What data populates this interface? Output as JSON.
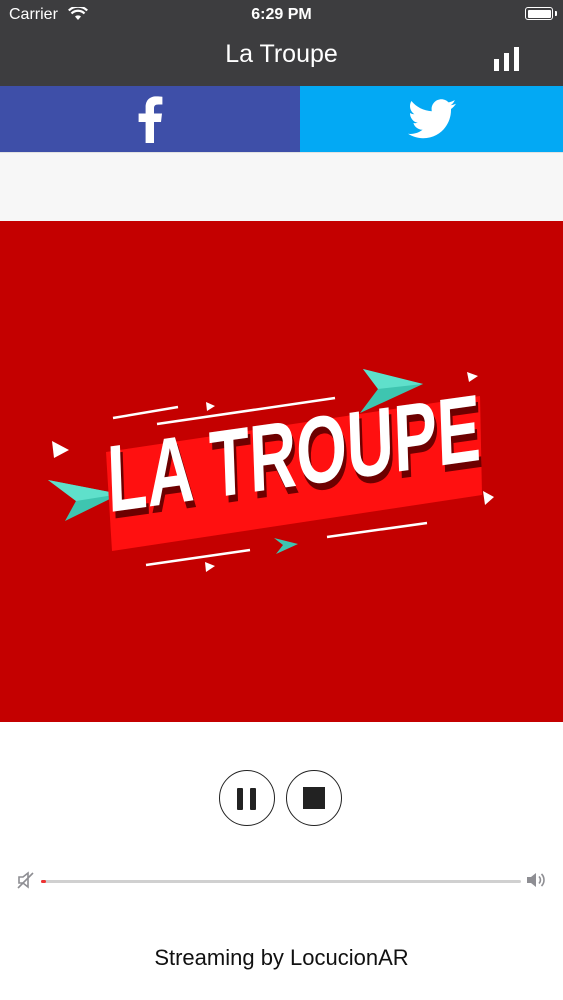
{
  "status_bar": {
    "carrier": "Carrier",
    "time": "6:29 PM",
    "wifi_icon": "wifi-icon",
    "battery_icon": "battery-icon"
  },
  "nav": {
    "title": "La Troupe",
    "stats_icon": "bar-chart-icon"
  },
  "social": {
    "facebook_icon": "facebook-icon",
    "twitter_icon": "twitter-icon",
    "facebook_color": "#3e4fa8",
    "twitter_color": "#03a9f4"
  },
  "logo": {
    "text": "LA TROUPE",
    "background_color": "#c40000"
  },
  "player": {
    "pause_icon": "pause-icon",
    "stop_icon": "stop-icon",
    "mute_icon": "volume-mute-icon",
    "volume_icon": "volume-up-icon",
    "volume_level": 0.01
  },
  "footer": {
    "credit": "Streaming by LocucionAR"
  }
}
